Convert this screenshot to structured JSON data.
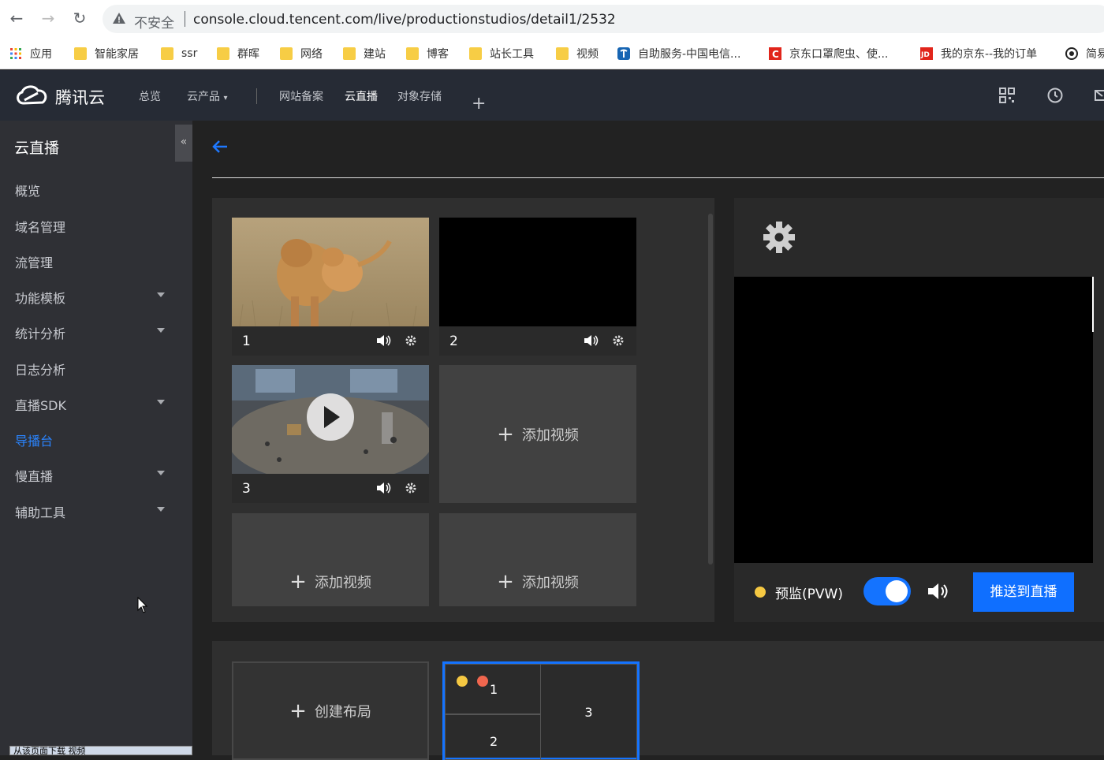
{
  "browser": {
    "insecure_label": "不安全",
    "url": "console.cloud.tencent.com/live/productionstudios/detail1/2532",
    "bookmarks": [
      "应用",
      "智能家居",
      "ssr",
      "群晖",
      "网络",
      "建站",
      "博客",
      "站长工具",
      "视频",
      "自助服务-中国电信...",
      "京东口罩爬虫、使...",
      "我的京东--我的订单",
      "简易"
    ]
  },
  "topnav": {
    "logo_text": "腾讯云",
    "items": [
      "总览",
      "云产品",
      "网站备案",
      "云直播",
      "对象存储"
    ],
    "plus": "+"
  },
  "sidebar": {
    "title": "云直播",
    "collapse": "«",
    "items": [
      {
        "label": "概览"
      },
      {
        "label": "域名管理"
      },
      {
        "label": "流管理"
      },
      {
        "label": "功能模板"
      },
      {
        "label": "统计分析"
      },
      {
        "label": "日志分析"
      },
      {
        "label": "直播SDK"
      },
      {
        "label": "导播台"
      },
      {
        "label": "慢直播"
      },
      {
        "label": "辅助工具"
      }
    ],
    "taskbar_text": "从该页面下载 视频"
  },
  "sources": {
    "tiles": [
      {
        "num": "1"
      },
      {
        "num": "2"
      },
      {
        "num": "3"
      }
    ],
    "add_video_label": "添加视频",
    "plus": "+"
  },
  "preview": {
    "label": "预监(PVW)",
    "push_button": "推送到直播"
  },
  "layouts": {
    "create_label": "创建布局",
    "plus": "+",
    "cells": [
      "1",
      "2",
      "3"
    ]
  },
  "colors": {
    "accent": "#1473ff",
    "dot_yellow": "#f5c842",
    "dot_red": "#f0664e"
  }
}
